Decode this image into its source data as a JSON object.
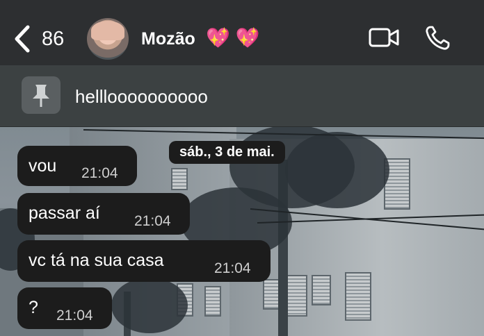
{
  "header": {
    "back_icon": "chevron-left-icon",
    "unread_count": "86",
    "contact_name": "Mozão",
    "contact_emoji": "💖 💖",
    "video_icon": "video-camera-icon",
    "call_icon": "phone-icon"
  },
  "pinned": {
    "icon": "pin-icon",
    "text": "hellloooooooooo"
  },
  "date_separator": "sáb., 3 de mai.",
  "messages": [
    {
      "text": "vou",
      "time": "21:04"
    },
    {
      "text": "passar aí",
      "time": "21:04"
    },
    {
      "text": "vc tá na sua casa",
      "time": "21:04"
    },
    {
      "text": "?",
      "time": "21:04"
    }
  ],
  "colors": {
    "header_bg": "#2d2f31",
    "bubble_bg": "#1c1c1c",
    "heart": "#ff5fb0"
  }
}
